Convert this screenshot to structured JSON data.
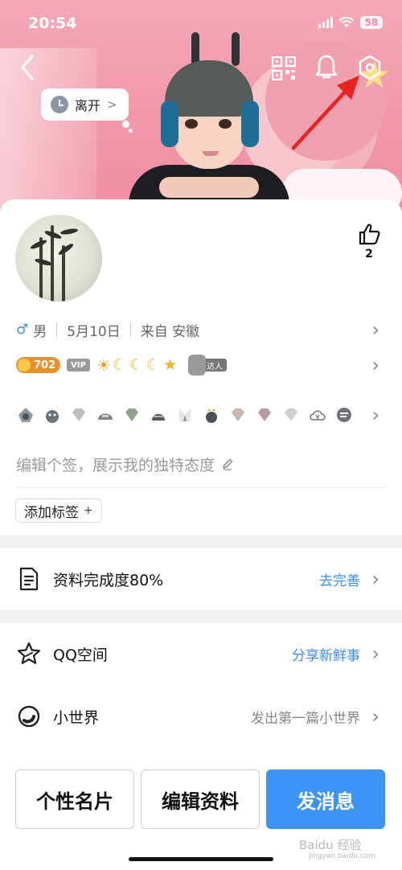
{
  "status_bar": {
    "time": "20:54",
    "battery": "58"
  },
  "header": {
    "away_status": "离开"
  },
  "profile": {
    "like_count": "2",
    "gender": "男",
    "birthday": "5月10日",
    "location": "来自 安徽",
    "level_value": "702",
    "vip_label": "VIP",
    "daren_label": "达人",
    "signature_placeholder": "编辑个签，展示我的独特态度",
    "add_tag_label": "添加标签"
  },
  "menu": {
    "completeness_label": "资料完成度80%",
    "completeness_action": "去完善",
    "qzone_label": "QQ空间",
    "qzone_action": "分享新鲜事",
    "world_label": "小世界",
    "world_action": "发出第一篇小世界"
  },
  "buttons": {
    "card": "个性名片",
    "edit": "编辑资料",
    "message": "发消息"
  },
  "watermark": {
    "main": "Baidu 经验",
    "sub": "jingyan.baidu.com"
  },
  "colors": {
    "accent_blue": "#3b94f5",
    "banner_pink": "#f29aab",
    "arrow_red": "#e8231f"
  }
}
